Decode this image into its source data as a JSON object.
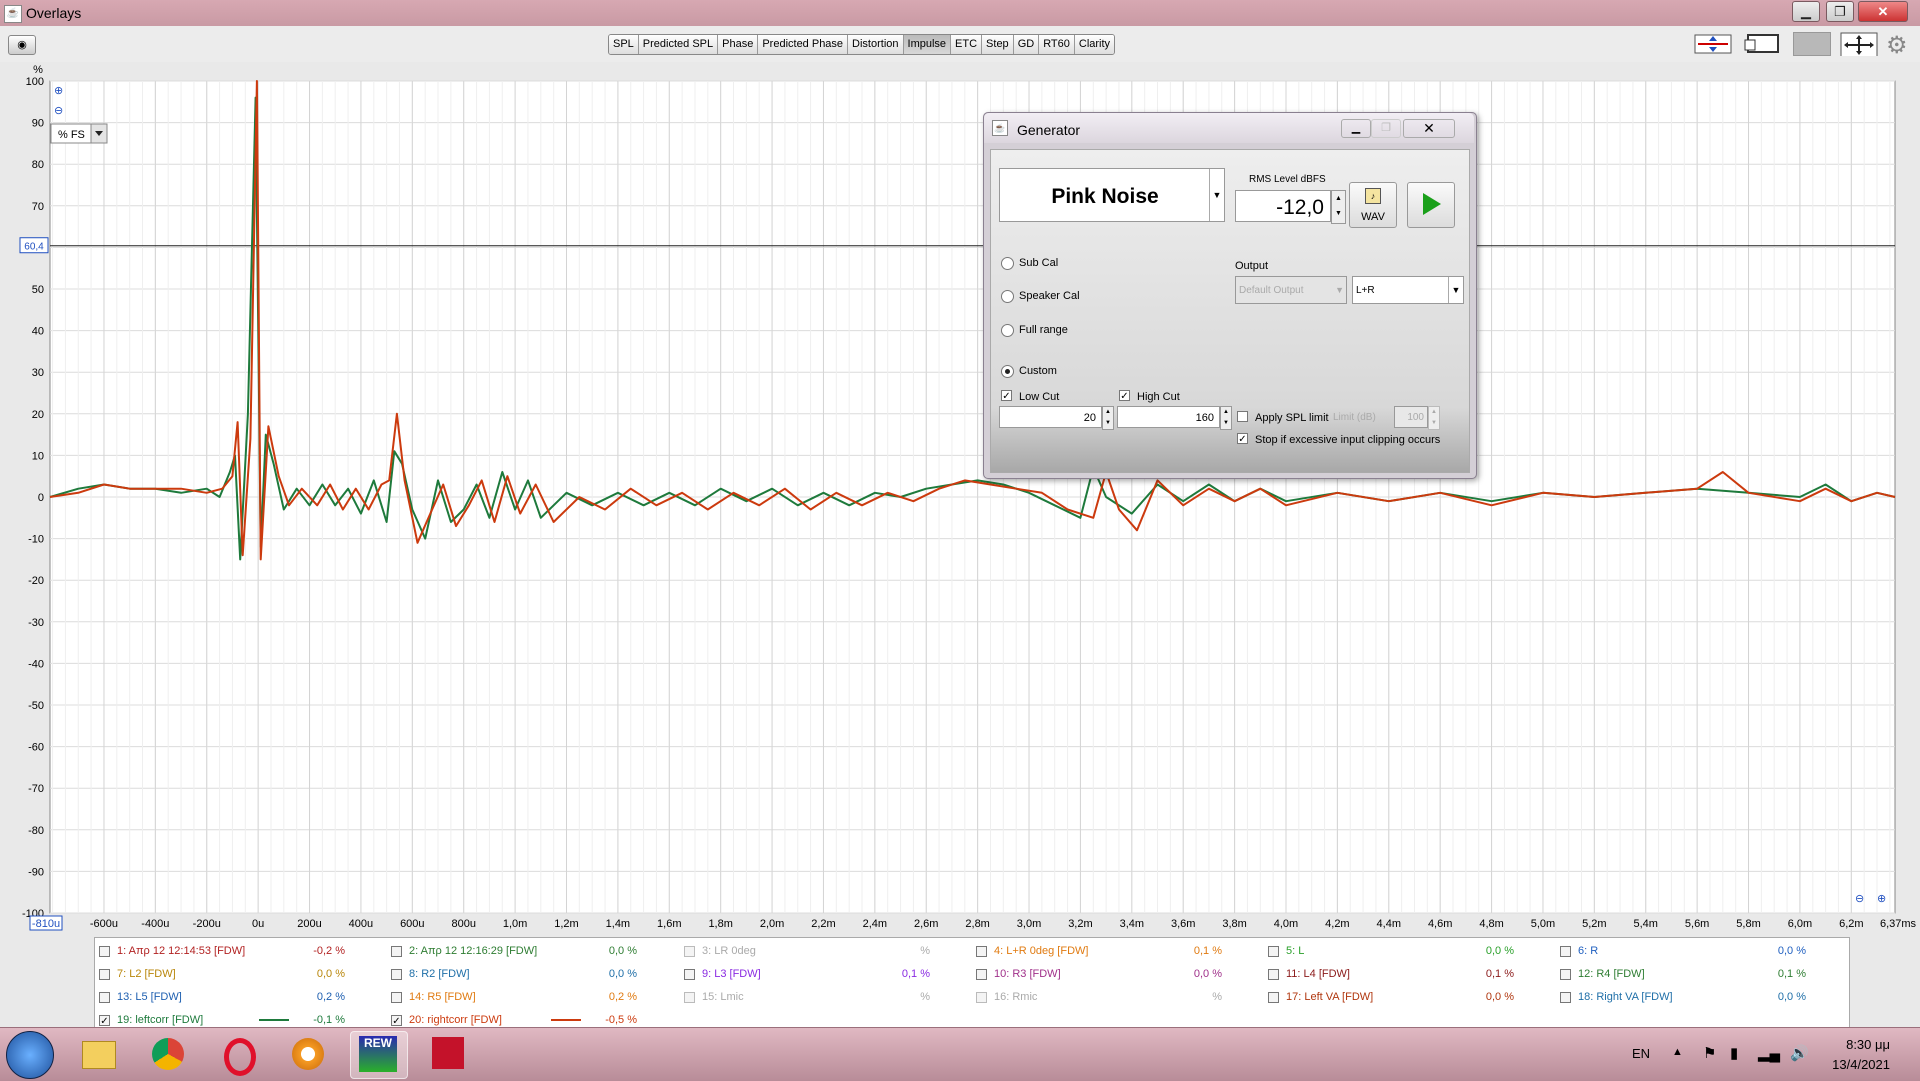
{
  "window": {
    "title": "Overlays"
  },
  "toolbar": {
    "tabs": [
      "SPL",
      "Predicted SPL",
      "Phase",
      "Predicted Phase",
      "Distortion",
      "Impulse",
      "ETC",
      "Step",
      "GD",
      "RT60",
      "Clarity"
    ],
    "active_tab": "Impulse"
  },
  "chart_data": {
    "type": "line",
    "ylabel": "%",
    "unit_selector": "% FS",
    "cursor_value": "60,4",
    "x_start_label": "-810u",
    "x_end_label": "6,37ms",
    "x_ticks": [
      "-600u",
      "-400u",
      "-200u",
      "0u",
      "200u",
      "400u",
      "600u",
      "800u",
      "1,0m",
      "1,2m",
      "1,4m",
      "1,6m",
      "1,8m",
      "2,0m",
      "2,2m",
      "2,4m",
      "2,6m",
      "2,8m",
      "3,0m",
      "3,2m",
      "3,4m",
      "3,6m",
      "3,8m",
      "4,0m",
      "4,2m",
      "4,4m",
      "4,6m",
      "4,8m",
      "5,0m",
      "5,2m",
      "5,4m",
      "5,6m",
      "5,8m",
      "6,0m",
      "6,2m"
    ],
    "y_ticks": [
      100,
      90,
      80,
      70,
      60,
      50,
      40,
      30,
      20,
      10,
      0,
      -10,
      -20,
      -30,
      -40,
      -50,
      -60,
      -70,
      -80,
      -90,
      -100
    ],
    "xlim_us": [
      -810,
      6370
    ],
    "ylim": [
      -100,
      100
    ],
    "grid": true,
    "series": [
      {
        "name": "19: leftcorr [FDW]",
        "color": "#1e7a3c",
        "x": [
          -810,
          -700,
          -600,
          -500,
          -400,
          -300,
          -200,
          -150,
          -110,
          -90,
          -70,
          -40,
          -10,
          10,
          30,
          60,
          100,
          150,
          200,
          250,
          300,
          350,
          400,
          450,
          500,
          530,
          560,
          600,
          650,
          700,
          750,
          800,
          850,
          900,
          950,
          1000,
          1050,
          1100,
          1200,
          1300,
          1400,
          1500,
          1600,
          1700,
          1800,
          1900,
          2000,
          2100,
          2200,
          2300,
          2400,
          2500,
          2600,
          2700,
          2800,
          2900,
          3000,
          3100,
          3200,
          3250,
          3300,
          3400,
          3500,
          3600,
          3700,
          3800,
          3900,
          4000,
          4200,
          4400,
          4600,
          4800,
          5000,
          5200,
          5400,
          5600,
          5800,
          6000,
          6100,
          6200,
          6300,
          6370
        ],
        "y": [
          0,
          2,
          3,
          2,
          2,
          1,
          2,
          0,
          6,
          10,
          -15,
          20,
          96,
          -12,
          15,
          8,
          -3,
          2,
          -2,
          3,
          -2,
          2,
          -4,
          4,
          -6,
          11,
          8,
          -3,
          -10,
          4,
          -6,
          -3,
          3,
          -5,
          6,
          -3,
          4,
          -5,
          1,
          -2,
          1,
          -2,
          1,
          -2,
          2,
          -1,
          2,
          -2,
          1,
          -2,
          1,
          0,
          2,
          3,
          4,
          3,
          1,
          -2,
          -5,
          7,
          0,
          -4,
          3,
          -1,
          3,
          -1,
          2,
          -1,
          1,
          -1,
          1,
          -1,
          1,
          0,
          1,
          2,
          1,
          0,
          3,
          -1,
          1,
          0
        ]
      },
      {
        "name": "20: rightcorr [FDW]",
        "color": "#cc3a0e",
        "x": [
          -810,
          -700,
          -600,
          -500,
          -400,
          -300,
          -200,
          -140,
          -100,
          -80,
          -60,
          -30,
          -5,
          10,
          40,
          80,
          120,
          170,
          230,
          280,
          330,
          380,
          430,
          480,
          510,
          540,
          570,
          620,
          670,
          720,
          770,
          820,
          870,
          920,
          970,
          1020,
          1080,
          1150,
          1250,
          1350,
          1450,
          1550,
          1650,
          1750,
          1850,
          1950,
          2050,
          2150,
          2250,
          2350,
          2450,
          2550,
          2650,
          2750,
          2850,
          2950,
          3050,
          3150,
          3250,
          3300,
          3350,
          3420,
          3500,
          3600,
          3700,
          3800,
          3900,
          4000,
          4200,
          4400,
          4600,
          4800,
          5000,
          5200,
          5400,
          5600,
          5700,
          5800,
          6000,
          6100,
          6200,
          6300,
          6370
        ],
        "y": [
          0,
          1,
          3,
          2,
          2,
          2,
          1,
          2,
          5,
          18,
          -14,
          14,
          100,
          -15,
          17,
          5,
          -2,
          2,
          -2,
          3,
          -3,
          2,
          -3,
          3,
          4,
          20,
          4,
          -11,
          -4,
          3,
          -7,
          -2,
          4,
          -6,
          5,
          -4,
          3,
          -6,
          0,
          -3,
          2,
          -2,
          1,
          -3,
          1,
          -2,
          2,
          -3,
          1,
          -2,
          1,
          -1,
          2,
          4,
          3,
          2,
          1,
          -3,
          -5,
          6,
          -3,
          -8,
          4,
          -2,
          2,
          -1,
          2,
          -2,
          1,
          -1,
          1,
          -2,
          1,
          0,
          1,
          2,
          6,
          1,
          -1,
          2,
          -1,
          1,
          0
        ]
      }
    ]
  },
  "legend": {
    "entries": [
      {
        "label": "1: Απρ 12 12:14:53 [FDW]",
        "value": "-0,2 %",
        "color": "#b22222",
        "checked": false,
        "enabled": true
      },
      {
        "label": "2: Απρ 12 12:16:29 [FDW]",
        "value": "0,0 %",
        "color": "#2e7d32",
        "checked": false,
        "enabled": true
      },
      {
        "label": "3: LR 0deg",
        "value": "%",
        "color": "#9e9e9e",
        "checked": false,
        "enabled": false
      },
      {
        "label": "4: L+R 0deg [FDW]",
        "value": "0,1 %",
        "color": "#e07a10",
        "checked": false,
        "enabled": true
      },
      {
        "label": "5: L",
        "value": "0,0 %",
        "color": "#2aa02a",
        "checked": false,
        "enabled": true
      },
      {
        "label": "6: R",
        "value": "0,0 %",
        "color": "#2060c0",
        "checked": false,
        "enabled": true
      },
      {
        "label": "7: L2 [FDW]",
        "value": "0,0 %",
        "color": "#b8860b",
        "checked": false,
        "enabled": true
      },
      {
        "label": "8: R2 [FDW]",
        "value": "0,0 %",
        "color": "#1f6fa8",
        "checked": false,
        "enabled": true
      },
      {
        "label": "9: L3 [FDW]",
        "value": "0,1 %",
        "color": "#8a2be2",
        "checked": false,
        "enabled": true
      },
      {
        "label": "10: R3 [FDW]",
        "value": "0,0 %",
        "color": "#a0308a",
        "checked": false,
        "enabled": true
      },
      {
        "label": "11: L4 [FDW]",
        "value": "0,1 %",
        "color": "#8b1a1a",
        "checked": false,
        "enabled": true
      },
      {
        "label": "12: R4 [FDW]",
        "value": "0,1 %",
        "color": "#2e7d32",
        "checked": false,
        "enabled": true
      },
      {
        "label": "13: L5 [FDW]",
        "value": "0,2 %",
        "color": "#1e5fb0",
        "checked": false,
        "enabled": true
      },
      {
        "label": "14: R5 [FDW]",
        "value": "0,2 %",
        "color": "#e07a10",
        "checked": false,
        "enabled": true
      },
      {
        "label": "15: Lmic",
        "value": "%",
        "color": "#9e9e9e",
        "checked": false,
        "enabled": false
      },
      {
        "label": "16: Rmic",
        "value": "%",
        "color": "#9e9e9e",
        "checked": false,
        "enabled": false
      },
      {
        "label": "17: Left VA [FDW]",
        "value": "0,0 %",
        "color": "#b0360e",
        "checked": false,
        "enabled": true
      },
      {
        "label": "18: Right VA [FDW]",
        "value": "0,0 %",
        "color": "#1f6fa8",
        "checked": false,
        "enabled": true
      },
      {
        "label": "19: leftcorr [FDW]",
        "value": "-0,1 %",
        "color": "#1e7a3c",
        "checked": true,
        "enabled": true
      },
      {
        "label": "20: rightcorr [FDW]",
        "value": "-0,5 %",
        "color": "#cc3a0e",
        "checked": true,
        "enabled": true
      }
    ]
  },
  "generator": {
    "title": "Generator",
    "signal": "Pink Noise",
    "rms_label": "RMS Level dBFS",
    "rms_value": "-12,0",
    "wav_label": "WAV",
    "output_label": "Output",
    "output_device": "Default Output",
    "output_channel": "L+R",
    "radios": [
      "Sub Cal",
      "Speaker Cal",
      "Full range",
      "Custom"
    ],
    "selected_radio": "Custom",
    "low_cut_label": "Low Cut",
    "low_cut_value": "20",
    "high_cut_label": "High Cut",
    "high_cut_value": "160",
    "apply_spl_label": "Apply SPL limit",
    "limit_label": "Limit (dB)",
    "limit_value": "100",
    "stop_clip_label": "Stop if excessive input clipping occurs"
  },
  "taskbar": {
    "language": "EN",
    "time": "8:30 μμ",
    "date": "13/4/2021"
  }
}
